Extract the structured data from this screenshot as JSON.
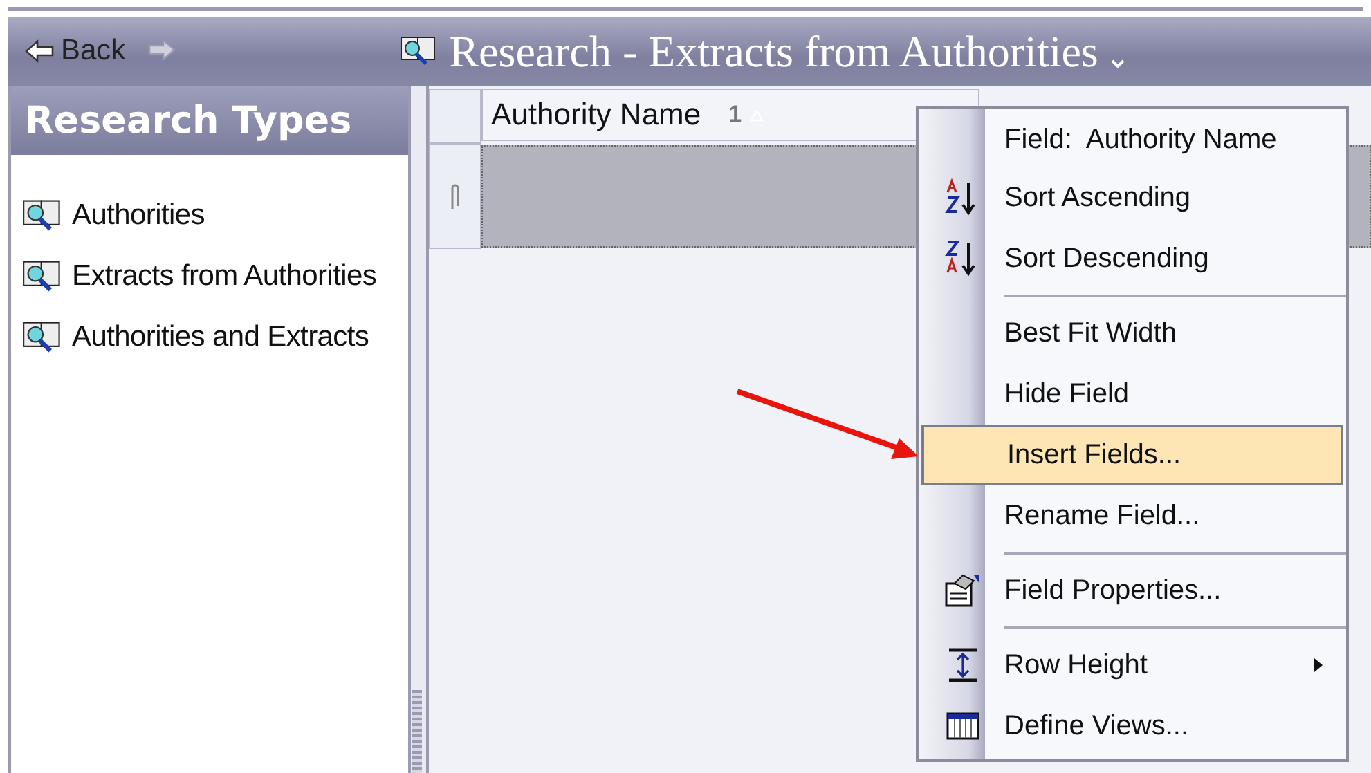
{
  "toolbar": {
    "back": "Back",
    "title": "Research - Extracts from Authorities"
  },
  "sidebar": {
    "title": "Research Types",
    "items": [
      {
        "label": "Authorities",
        "selected": false
      },
      {
        "label": "Extracts from Authorities",
        "selected": false
      },
      {
        "label": "Authorities and Extracts",
        "selected": false
      }
    ]
  },
  "grid": {
    "columns": [
      {
        "label": "Authority Name",
        "sort_order": "1"
      }
    ],
    "rows": [
      {
        "selected": true
      }
    ]
  },
  "context_menu": {
    "groups": [
      [
        {
          "label": "Field:  Authority Name",
          "kind": "header",
          "highlighted": false
        },
        {
          "label": "Sort Ascending",
          "kind": "command",
          "highlighted": false
        },
        {
          "label": "Sort Descending",
          "kind": "command",
          "highlighted": false
        }
      ],
      [
        {
          "label": "Best Fit Width",
          "kind": "command",
          "highlighted": false
        },
        {
          "label": "Hide Field",
          "kind": "command",
          "highlighted": false
        },
        {
          "label": "Insert Fields...",
          "kind": "command",
          "highlighted": true
        },
        {
          "label": "Rename Field...",
          "kind": "command",
          "highlighted": false
        }
      ],
      [
        {
          "label": "Field Properties...",
          "kind": "command",
          "highlighted": false
        }
      ],
      [
        {
          "label": "Row Height",
          "kind": "submenu",
          "highlighted": false
        },
        {
          "label": "Define Views...",
          "kind": "command",
          "highlighted": false
        }
      ]
    ]
  }
}
